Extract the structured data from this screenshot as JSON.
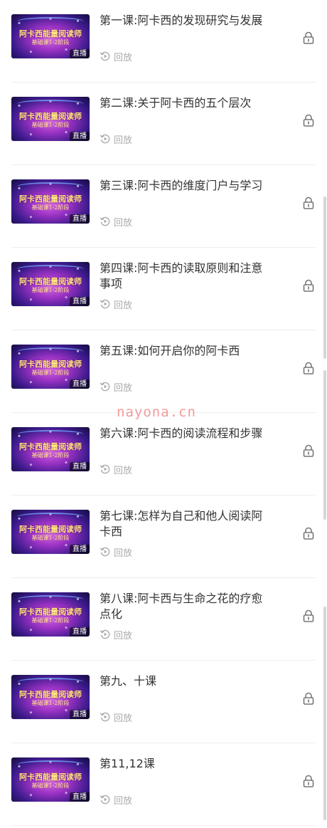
{
  "lessons": [
    {
      "title": "第一课:阿卡西的发现研究与发展",
      "badge": "直播",
      "replay": "回放"
    },
    {
      "title": "第二课:关于阿卡西的五个层次",
      "badge": "直播",
      "replay": "回放"
    },
    {
      "title": "第三课:阿卡西的维度门户与学习",
      "badge": "直播",
      "replay": "回放"
    },
    {
      "title": "第四课:阿卡西的读取原则和注意事项",
      "badge": "直播",
      "replay": "回放"
    },
    {
      "title": "第五课:如何开启你的阿卡西",
      "badge": "直播",
      "replay": "回放"
    },
    {
      "title": "第六课:阿卡西的阅读流程和步骤",
      "badge": "直播",
      "replay": "回放"
    },
    {
      "title": "第七课:怎样为自己和他人阅读阿卡西",
      "badge": "直播",
      "replay": "回放"
    },
    {
      "title": "第八课:阿卡西与生命之花的疗愈点化",
      "badge": "直播",
      "replay": "回放"
    },
    {
      "title": "第九、十课",
      "badge": "直播",
      "replay": "回放"
    },
    {
      "title": "第11,12课",
      "badge": "直播",
      "replay": "回放"
    }
  ],
  "thumbnail": {
    "line1": "阿卡西能量阅读师",
    "line2": "基础课1-2阶段"
  },
  "icons": {
    "replay": "replay-icon",
    "lock": "lock-icon"
  },
  "watermark": "nayona.cn",
  "colors": {
    "title": "#333333",
    "muted": "#aaaaaa",
    "divider": "#eeeeee",
    "watermark": "#f08a8a"
  }
}
